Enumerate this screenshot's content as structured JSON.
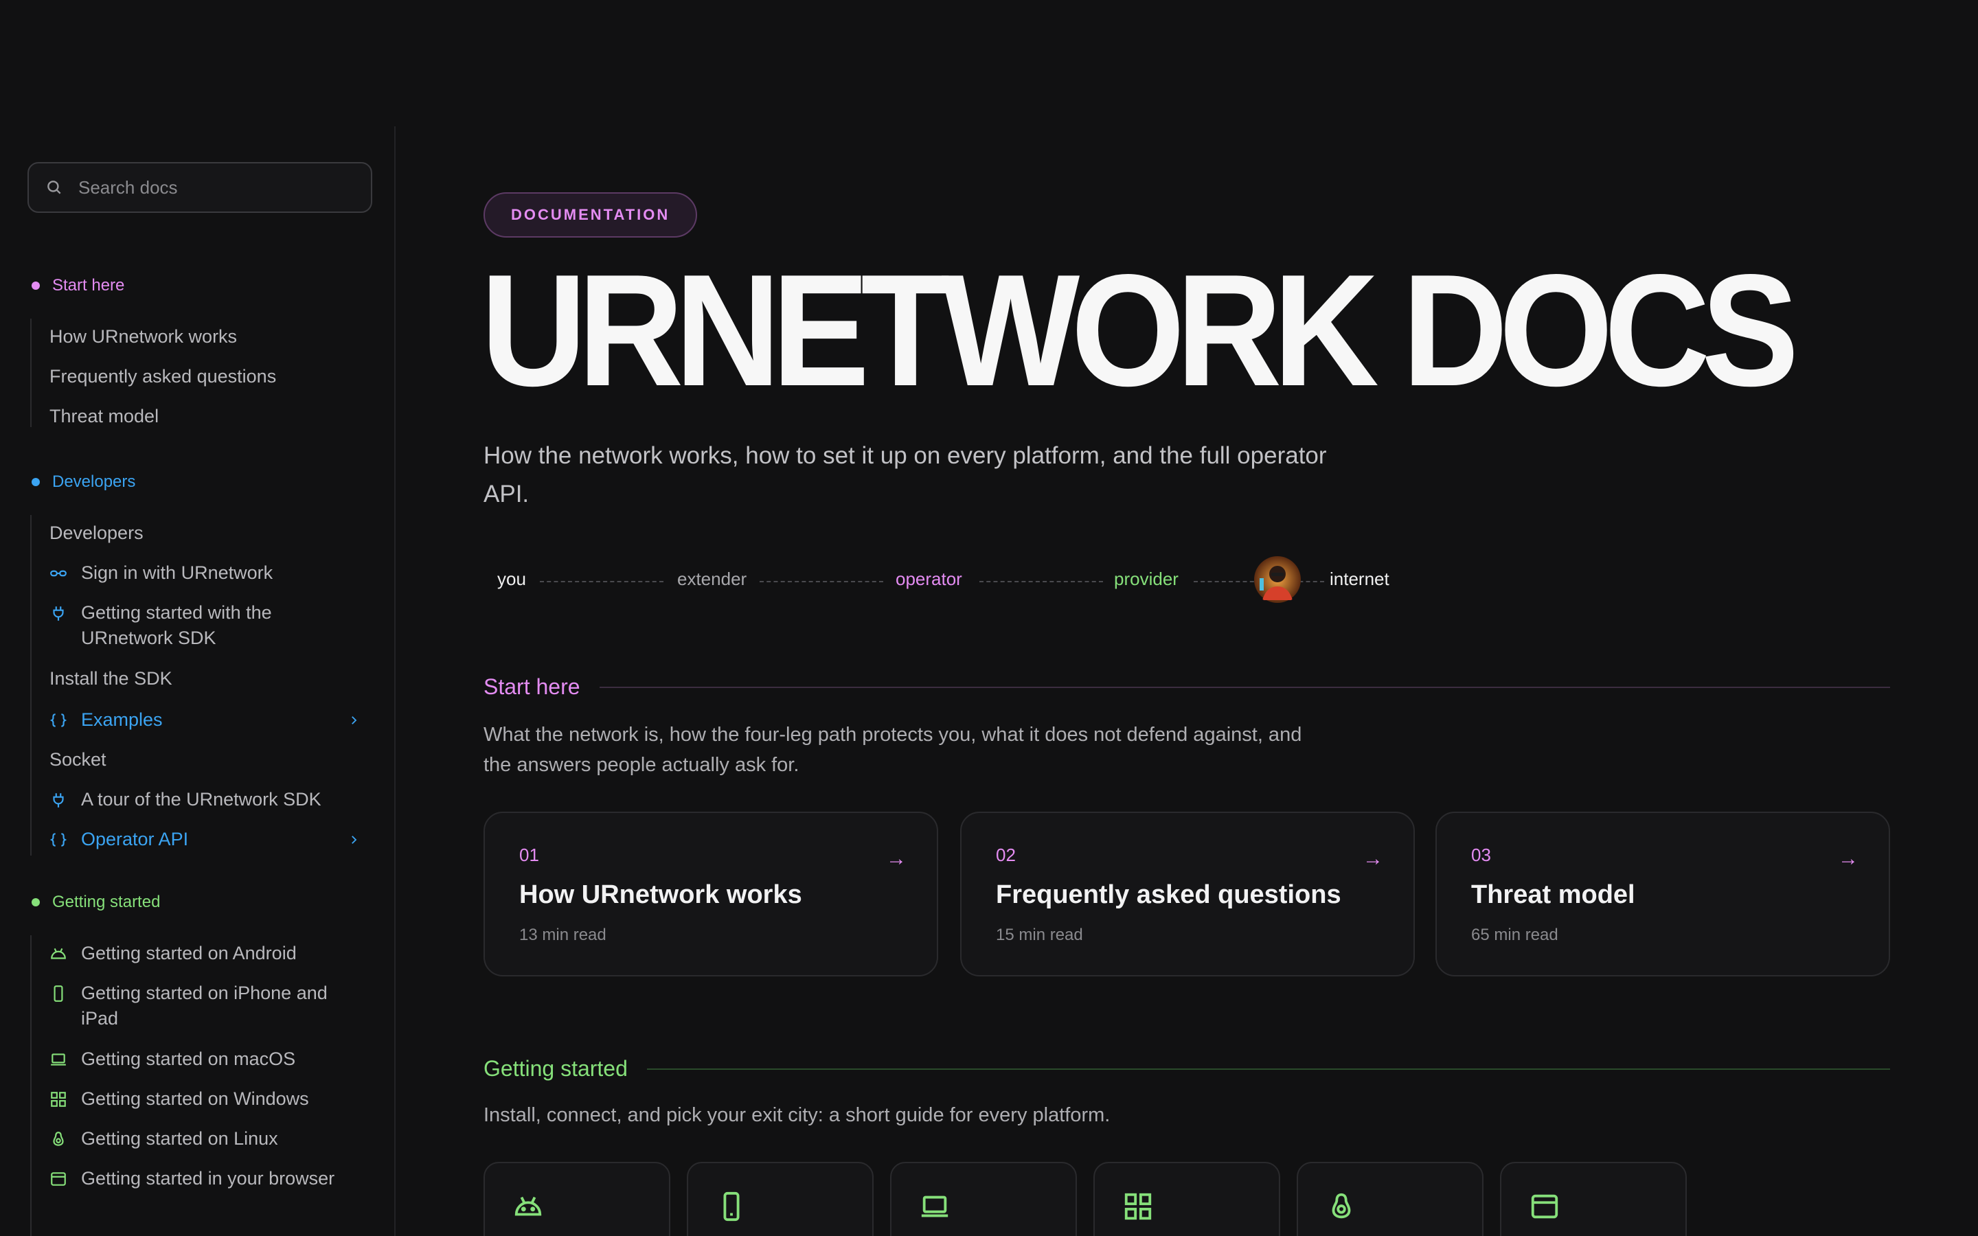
{
  "sidebar": {
    "search_placeholder": "Search docs",
    "groups": [
      {
        "label": "Start here",
        "color": "#e48cf2",
        "items": [
          {
            "label": "How URnetwork works"
          },
          {
            "label": "Frequently asked questions"
          },
          {
            "label": "Threat model"
          }
        ]
      },
      {
        "label": "Developers",
        "color": "#3ba4f2",
        "items": [
          {
            "label": "Developers"
          },
          {
            "label": "Sign in with URnetwork",
            "icon": "link-icon"
          },
          {
            "label": "Getting started with the URnetwork SDK",
            "icon": "plug-icon"
          },
          {
            "label": "Install the SDK"
          },
          {
            "label": "Examples",
            "icon": "braces-icon",
            "expandable": true
          },
          {
            "label": "Socket"
          },
          {
            "label": "A tour of the URnetwork SDK",
            "icon": "plug-icon"
          },
          {
            "label": "Operator API",
            "icon": "braces-icon",
            "expandable": true
          }
        ]
      },
      {
        "label": "Getting started",
        "color": "#86e07a",
        "items": [
          {
            "label": "Getting started on Android",
            "icon": "android-icon"
          },
          {
            "label": "Getting started on iPhone and iPad",
            "icon": "phone-icon"
          },
          {
            "label": "Getting started on macOS",
            "icon": "laptop-icon"
          },
          {
            "label": "Getting started on Windows",
            "icon": "windows-icon"
          },
          {
            "label": "Getting started on Linux",
            "icon": "linux-icon"
          },
          {
            "label": "Getting started in your browser",
            "icon": "browser-icon"
          }
        ]
      }
    ]
  },
  "main": {
    "badge": "DOCUMENTATION",
    "title": "URNETWORK DOCS",
    "lead": "How the network works, how to set it up on every platform, and the full operator API.",
    "path": {
      "nodes": [
        "you",
        "extender",
        "operator",
        "provider",
        "internet"
      ],
      "colors": [
        "#f0f0f0",
        "#a8a8ac",
        "#e48cf2",
        "#86e07a",
        "#f0f0f0"
      ]
    },
    "start_here": {
      "heading": "Start here",
      "description": "What the network is, how the four-leg path protects you, what it does not defend against, and the answers people actually ask for.",
      "cards": [
        {
          "num": "01",
          "title": "How URnetwork works",
          "meta": "13 min read",
          "arrow": "→"
        },
        {
          "num": "02",
          "title": "Frequently asked questions",
          "meta": "15 min read",
          "arrow": "→"
        },
        {
          "num": "03",
          "title": "Threat model",
          "meta": "65 min read",
          "arrow": "→"
        }
      ]
    },
    "getting_started": {
      "heading": "Getting started",
      "description": "Install, connect, and pick your exit city: a short guide for every platform.",
      "platform_icons": [
        "android-icon",
        "phone-icon",
        "laptop-icon",
        "windows-icon",
        "linux-icon",
        "browser-icon"
      ]
    }
  },
  "colors": {
    "background": "#111112",
    "pink": "#e48cf2",
    "blue": "#3ba4f2",
    "green": "#86e07a"
  }
}
